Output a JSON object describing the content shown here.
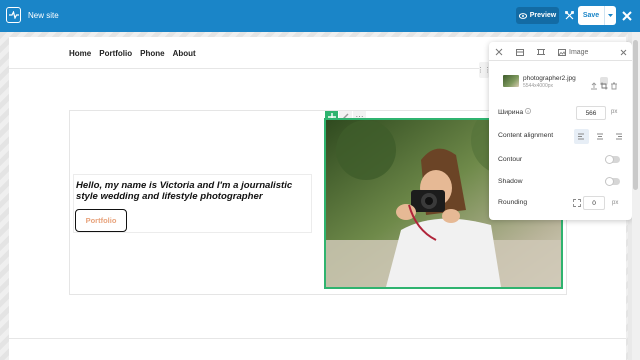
{
  "topbar": {
    "site_title": "New site",
    "preview_label": "Preview",
    "save_label": "Save"
  },
  "nav": {
    "items": [
      "Home",
      "Portfolio",
      "Phone",
      "About"
    ]
  },
  "hero": {
    "headline": "Hello, my name is Victoria and I'm a journalistic style wedding and lifestyle photographer",
    "button_label": "Portfolio"
  },
  "photo_tools": {
    "more": "···"
  },
  "panel": {
    "tab_image_label": "Image",
    "file_name": "photographer2.jpg",
    "file_size": "5544x4000px",
    "width_label": "Ширина",
    "width_value": "566",
    "width_unit": "px",
    "alignment_label": "Content alignment",
    "contour_label": "Contour",
    "shadow_label": "Shadow",
    "rounding_label": "Rounding",
    "rounding_value": "0",
    "rounding_unit": "px",
    "contour_on": false,
    "shadow_on": false
  },
  "colors": {
    "topbar": "#1a85c8",
    "selection": "#2fb36f",
    "button_text": "#e8a37c"
  }
}
